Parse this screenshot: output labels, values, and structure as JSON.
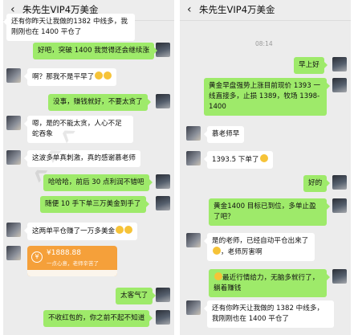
{
  "left": {
    "header": {
      "back_icon": "chevron-left-icon",
      "title": "朱先生VIP4万美金"
    },
    "messages": [
      {
        "text": "还有你昨天让我做的1382 中线多，我刚刚也在 1400 平仓了"
      },
      {
        "text": "好吧，突破 1400 我觉得还会继续涨"
      },
      {
        "text": "啊？那我不是平早了"
      },
      {
        "text": "没事，赚钱就好，不要太贪了"
      },
      {
        "text": "嗯，是的不能太贪，人心不足蛇吞象"
      },
      {
        "text": "这波多单真刺激，真的感谢慕老师"
      },
      {
        "text": "哈哈哈，前后 30 点利润不错吧"
      },
      {
        "text": "随便 10 手下单三万美金到手了"
      },
      {
        "text": "这两单平仓赚了一万多美金"
      },
      {
        "text": "太客气了"
      },
      {
        "text": "不收红包的，你之前不起不知道"
      }
    ],
    "red_packet": {
      "amount": "¥1888.88",
      "subtitle": "一点心意，老师辛苦了"
    }
  },
  "right": {
    "header": {
      "back_icon": "chevron-left-icon",
      "title": "朱先生VIP4万美金"
    },
    "timestamp": "08:14",
    "messages": [
      {
        "text": "早上好"
      },
      {
        "text": "黄金早盘强势上涨目前现价 1393 一线直接多，止损 1389，牧场 1398-1400"
      },
      {
        "text": "慕老师早"
      },
      {
        "text": "1393.5 下单了"
      },
      {
        "text": "好的"
      },
      {
        "text": "黄金1400 目标已到位，多单止盈了吧？"
      },
      {
        "text": "是的老师，已经自动平仓出来了"
      },
      {
        "text": "，老师厉害啊"
      },
      {
        "text": "最近行情给力，无脑多就行了，躺着赚钱"
      },
      {
        "text": "还有你昨天让我做的 1382 中线多，我刚刚也在 1400 平仓了"
      }
    ]
  },
  "colors": {
    "out_bubble": "#9eea6a",
    "in_bubble": "#ffffff",
    "background": "#ececec",
    "red_packet": "#f5a03a"
  }
}
